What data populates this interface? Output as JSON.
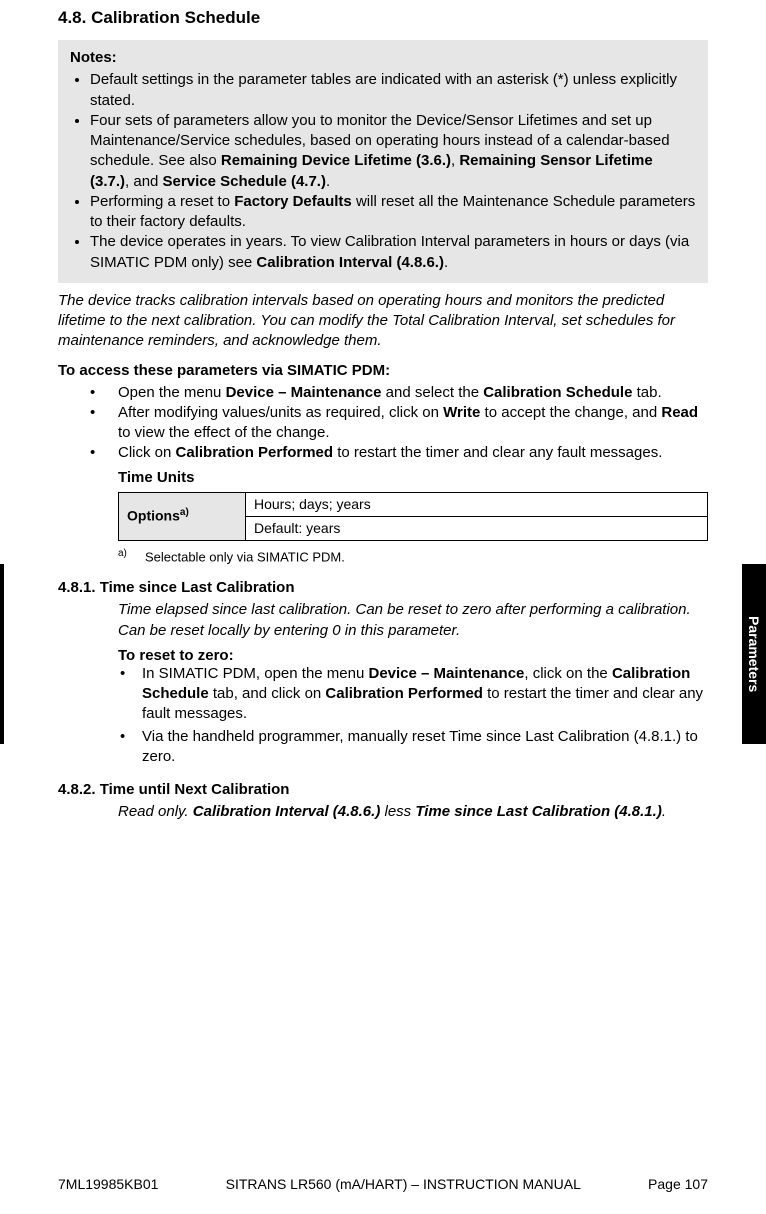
{
  "section": {
    "number": "4.8.",
    "title": "Calibration Schedule"
  },
  "notes": {
    "heading": "Notes:",
    "items": [
      {
        "parts": [
          {
            "t": "Default settings in the parameter tables are indicated with an asterisk (*) unless explicitly stated."
          }
        ]
      },
      {
        "parts": [
          {
            "t": "Four sets of parameters allow you to monitor the Device/Sensor Lifetimes and set up Maintenance/Service schedules, based on operating hours instead of a calendar-based schedule. See also "
          },
          {
            "t": "Remaining Device Lifetime (3.6.)",
            "b": true
          },
          {
            "t": ", "
          },
          {
            "t": "Remaining Sensor Lifetime (3.7.)",
            "b": true
          },
          {
            "t": ", and "
          },
          {
            "t": "Service Schedule (4.7.)",
            "b": true
          },
          {
            "t": "."
          }
        ]
      },
      {
        "parts": [
          {
            "t": "Performing a reset to "
          },
          {
            "t": "Factory Defaults",
            "b": true
          },
          {
            "t": " will reset all the Maintenance Schedule parameters to their factory defaults."
          }
        ]
      },
      {
        "parts": [
          {
            "t": "The device operates in years. To view Calibration Interval parameters in hours or days (via SIMATIC PDM only) see "
          },
          {
            "t": "Calibration Interval (4.8.6.)",
            "b": true
          },
          {
            "t": "."
          }
        ]
      }
    ]
  },
  "intro": "The device tracks calibration intervals based on operating hours and monitors the predicted lifetime to the next calibration. You can modify the Total Calibration Interval, set schedules for maintenance reminders, and acknowledge them.",
  "access_heading": "To access these parameters via SIMATIC PDM:",
  "access_list": [
    {
      "parts": [
        {
          "t": "Open the menu "
        },
        {
          "t": "Device – Maintenance",
          "b": true
        },
        {
          "t": " and select the "
        },
        {
          "t": "Calibration Schedule",
          "b": true
        },
        {
          "t": " tab."
        }
      ]
    },
    {
      "parts": [
        {
          "t": "After modifying values/units as required, click on "
        },
        {
          "t": "Write",
          "b": true
        },
        {
          "t": " to accept the change, and "
        },
        {
          "t": "Read",
          "b": true
        },
        {
          "t": " to view the effect of the change."
        }
      ]
    },
    {
      "parts": [
        {
          "t": "Click on "
        },
        {
          "t": "Calibration Performed",
          "b": true
        },
        {
          "t": " to restart the timer and clear any fault messages."
        }
      ]
    }
  ],
  "time_units": {
    "heading": "Time Units",
    "options_label": "Options",
    "options_sup": "a)",
    "row1": "Hours; days; years",
    "row2": "Default: years",
    "footnote_mark": "a)",
    "footnote_text": "Selectable only via SIMATIC PDM."
  },
  "sub481": {
    "number": "4.8.1.",
    "title": "Time since Last Calibration",
    "ital": "Time elapsed since last calibration. Can be reset to zero after performing a calibration. Can be reset locally by entering 0 in this parameter.",
    "reset_heading": "To reset to zero:",
    "reset_items": [
      {
        "parts": [
          {
            "t": "In SIMATIC PDM, open the menu "
          },
          {
            "t": "Device – Maintenance",
            "b": true
          },
          {
            "t": ", click on the "
          },
          {
            "t": "Calibration Schedule",
            "b": true
          },
          {
            "t": " tab, and click on "
          },
          {
            "t": "Calibration Performed",
            "b": true
          },
          {
            "t": " to restart the timer and clear any fault messages."
          }
        ]
      },
      {
        "parts": [
          {
            "t": "Via the handheld programmer, manually reset Time since Last Calibration (4.8.1.) to zero."
          }
        ]
      }
    ]
  },
  "sub482": {
    "number": "4.8.2.",
    "title": "Time until Next Calibration",
    "ital_parts": [
      {
        "t": "Read only. "
      },
      {
        "t": "Calibration Interval (4.8.6.)",
        "b": true
      },
      {
        "t": " less "
      },
      {
        "t": "Time since Last Calibration (4.8.1.)",
        "b": true
      },
      {
        "t": "."
      }
    ]
  },
  "sidetab": "Parameters",
  "footer": {
    "left": "7ML19985KB01",
    "mid": "SITRANS LR560 (mA/HART) – INSTRUCTION MANUAL",
    "right": "Page 107"
  }
}
